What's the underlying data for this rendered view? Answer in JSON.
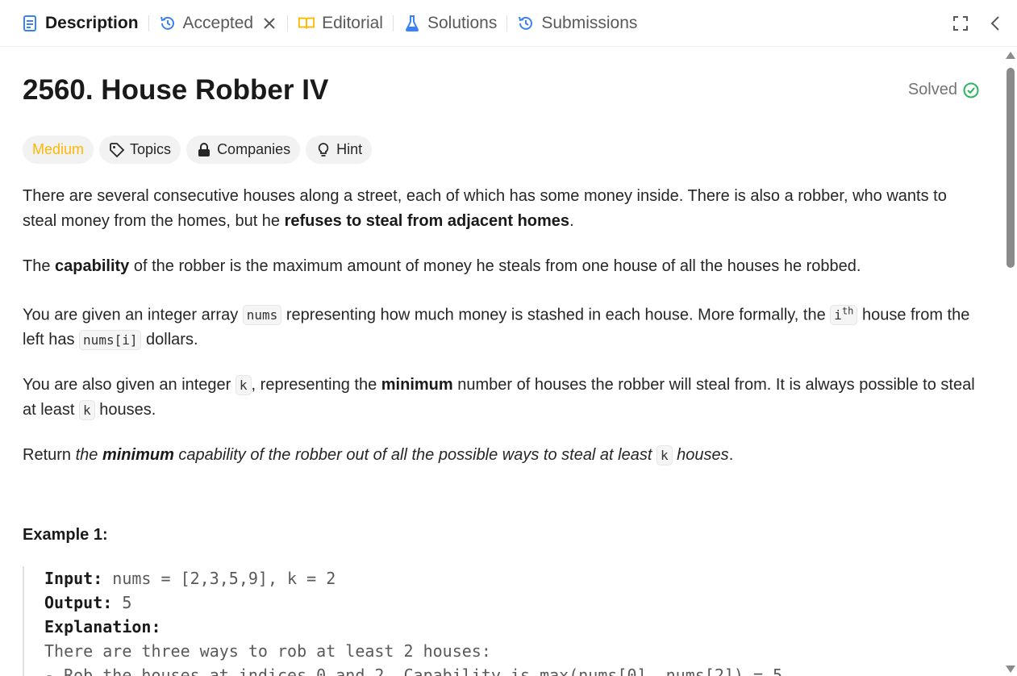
{
  "tabs": [
    {
      "label": "Description",
      "icon": "description-icon"
    },
    {
      "label": "Accepted",
      "icon": "history-icon"
    },
    {
      "label": "Editorial",
      "icon": "book-icon"
    },
    {
      "label": "Solutions",
      "icon": "flask-icon"
    },
    {
      "label": "Submissions",
      "icon": "history-icon"
    }
  ],
  "problem": {
    "title": "2560. House Robber IV",
    "status": "Solved",
    "difficulty": "Medium",
    "chips": {
      "topics": "Topics",
      "companies": "Companies",
      "hint": "Hint"
    }
  },
  "description": {
    "p1_a": "There are several consecutive houses along a street, each of which has some money inside. There is also a robber, who wants to steal money from the homes, but he ",
    "p1_b": "refuses to steal from adjacent homes",
    "p1_c": ".",
    "p2_a": "The ",
    "p2_b": "capability",
    "p2_c": " of the robber is the maximum amount of money he steals from one house of all the houses he robbed.",
    "p3_a": "You are given an integer array ",
    "p3_code1": "nums",
    "p3_b": " representing how much money is stashed in each house. More formally, the ",
    "p3_code2": "i",
    "p3_sup": "th",
    "p3_c": " house from the left has ",
    "p3_code3": "nums[i]",
    "p3_d": " dollars.",
    "p4_a": "You are also given an integer ",
    "p4_code1": "k",
    "p4_b": ", representing the ",
    "p4_bold": "minimum",
    "p4_c": " number of houses the robber will steal from. It is always possible to steal at least ",
    "p4_code2": "k",
    "p4_d": " houses.",
    "p5_a": "Return ",
    "p5_i1": "the ",
    "p5_bi": "minimum",
    "p5_i2": " capability of the robber out of all the possible ways to steal at least ",
    "p5_code": "k",
    "p5_i3": " houses",
    "p5_end": "."
  },
  "example1": {
    "title": "Example 1:",
    "input_label": "Input:",
    "input_value": " nums = [2,3,5,9], k = 2",
    "output_label": "Output:",
    "output_value": " 5",
    "explanation_label": "Explanation:",
    "line1": "There are three ways to rob at least 2 houses:",
    "line2": "- Rob the houses at indices 0 and 2. Capability is max(nums[0], nums[2]) = 5."
  },
  "colors": {
    "medium": "#ffb800",
    "solved_check": "#2db55d",
    "description_icon": "#3b82f6",
    "editorial_icon": "#ffb800",
    "flask_icon": "#3b82f6",
    "history_icon": "#3b82f6"
  }
}
